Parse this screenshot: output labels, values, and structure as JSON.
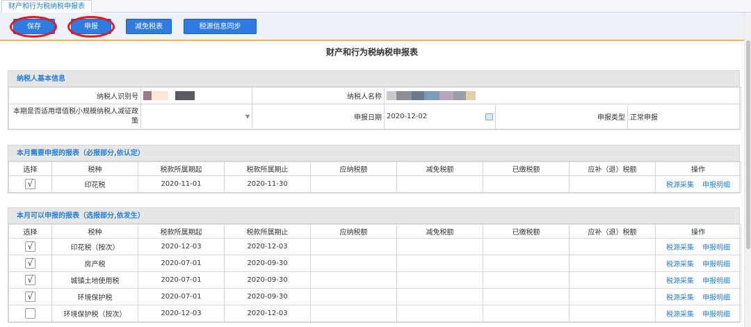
{
  "tab": {
    "label": "财产和行为税纳税申报表"
  },
  "toolbar": {
    "save": "保存",
    "declare": "申报",
    "relief": "减免税表",
    "sync": "税源信息同步",
    "annotation_color": "#e8161d"
  },
  "form_title": "财产和行为税纳税申报表",
  "basic": {
    "heading": "纳税人基本信息",
    "taxpayer_id_label": "纳税人识别号",
    "taxpayer_name_label": "纳税人名称",
    "policy_label": "本期是否适用增值税小规模纳税人减征政策",
    "declare_date_label": "申报日期",
    "declare_date": "2020-12-02",
    "declare_type_label": "申报类型",
    "declare_type": "正常申报"
  },
  "columns": {
    "select": "选择",
    "tax_type": "税种",
    "period_start": "税款所属期起",
    "period_end": "税款所属期止",
    "payable": "应纳税额",
    "relief": "减免税额",
    "paid": "已缴税额",
    "refund": "应补（退）税额",
    "ops": "操作"
  },
  "links": {
    "collect": "税源采集",
    "detail": "申报明细"
  },
  "required": {
    "heading": "本月需要申报的报表（必报部分,依认定）",
    "rows": [
      {
        "checked": true,
        "tax": "印花税",
        "start": "2020-11-01",
        "end": "2020-11-30"
      }
    ]
  },
  "optional": {
    "heading": "本月可以申报的报表（选报部分,依发生）",
    "rows": [
      {
        "checked": true,
        "tax": "印花税（按次）",
        "start": "2020-12-03",
        "end": "2020-12-03"
      },
      {
        "checked": true,
        "tax": "房产税",
        "start": "2020-07-01",
        "end": "2020-09-30"
      },
      {
        "checked": true,
        "tax": "城镇土地使用税",
        "start": "2020-07-01",
        "end": "2020-09-30"
      },
      {
        "checked": true,
        "tax": "环境保护税",
        "start": "2020-07-01",
        "end": "2020-09-30"
      },
      {
        "checked": false,
        "tax": "环境保护税（按次）",
        "start": "2020-12-03",
        "end": "2020-12-03"
      }
    ]
  }
}
